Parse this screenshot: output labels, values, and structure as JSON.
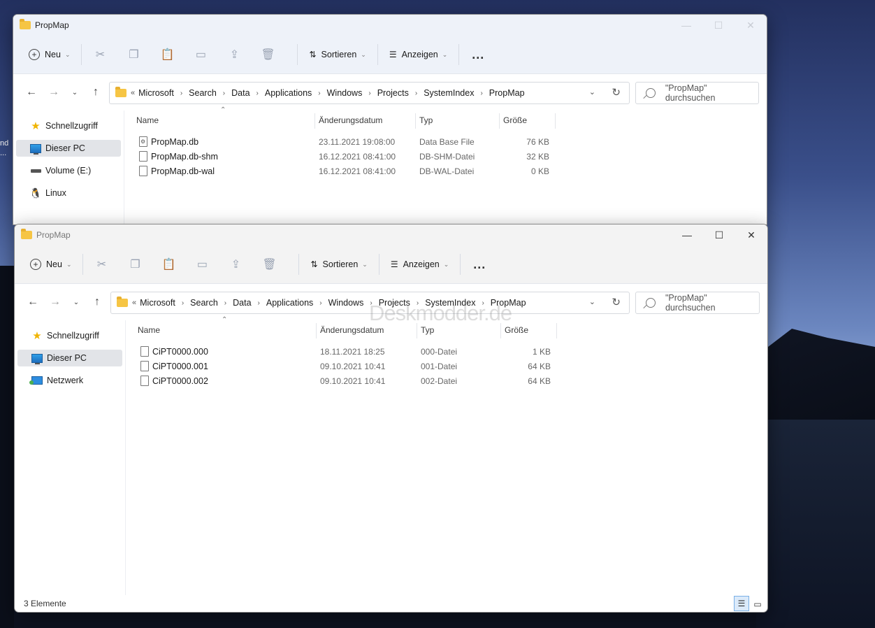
{
  "desktop": {
    "text_lines": [
      "nd",
      "..."
    ]
  },
  "window1": {
    "title": "PropMap",
    "toolbar": {
      "new_label": "Neu",
      "sort_label": "Sortieren",
      "view_label": "Anzeigen",
      "more_label": "..."
    },
    "address": {
      "prefix": "«",
      "crumbs": [
        "Microsoft",
        "Search",
        "Data",
        "Applications",
        "Windows",
        "Projects",
        "SystemIndex",
        "PropMap"
      ]
    },
    "search_placeholder": "\"PropMap\" durchsuchen",
    "sidebar": [
      {
        "label": "Schnellzugriff",
        "icon": "star-icon"
      },
      {
        "label": "Dieser PC",
        "icon": "pc-icon"
      },
      {
        "label": "Volume (E:)",
        "icon": "drive-icon"
      },
      {
        "label": "Linux",
        "icon": "penguin-icon"
      }
    ],
    "columns": [
      "Name",
      "Änderungsdatum",
      "Typ",
      "Größe"
    ],
    "files": [
      {
        "name": "PropMap.db",
        "date": "23.11.2021 19:08:00",
        "type": "Data Base File",
        "size": "76 KB"
      },
      {
        "name": "PropMap.db-shm",
        "date": "16.12.2021 08:41:00",
        "type": "DB-SHM-Datei",
        "size": "32 KB"
      },
      {
        "name": "PropMap.db-wal",
        "date": "16.12.2021 08:41:00",
        "type": "DB-WAL-Datei",
        "size": "0 KB"
      }
    ]
  },
  "window2": {
    "title": "PropMap",
    "toolbar": {
      "new_label": "Neu",
      "sort_label": "Sortieren",
      "view_label": "Anzeigen",
      "more_label": "..."
    },
    "address": {
      "prefix": "«",
      "crumbs": [
        "Microsoft",
        "Search",
        "Data",
        "Applications",
        "Windows",
        "Projects",
        "SystemIndex",
        "PropMap"
      ]
    },
    "search_placeholder": "\"PropMap\" durchsuchen",
    "sidebar": [
      {
        "label": "Schnellzugriff",
        "icon": "star-icon"
      },
      {
        "label": "Dieser PC",
        "icon": "pc-icon"
      },
      {
        "label": "Netzwerk",
        "icon": "network-icon"
      }
    ],
    "columns": [
      "Name",
      "Änderungsdatum",
      "Typ",
      "Größe"
    ],
    "files": [
      {
        "name": "CiPT0000.000",
        "date": "18.11.2021 18:25",
        "type": "000-Datei",
        "size": "1 KB"
      },
      {
        "name": "CiPT0000.001",
        "date": "09.10.2021 10:41",
        "type": "001-Datei",
        "size": "64 KB"
      },
      {
        "name": "CiPT0000.002",
        "date": "09.10.2021 10:41",
        "type": "002-Datei",
        "size": "64 KB"
      }
    ],
    "status": "3 Elemente"
  },
  "watermark": "Deskmodder.de"
}
